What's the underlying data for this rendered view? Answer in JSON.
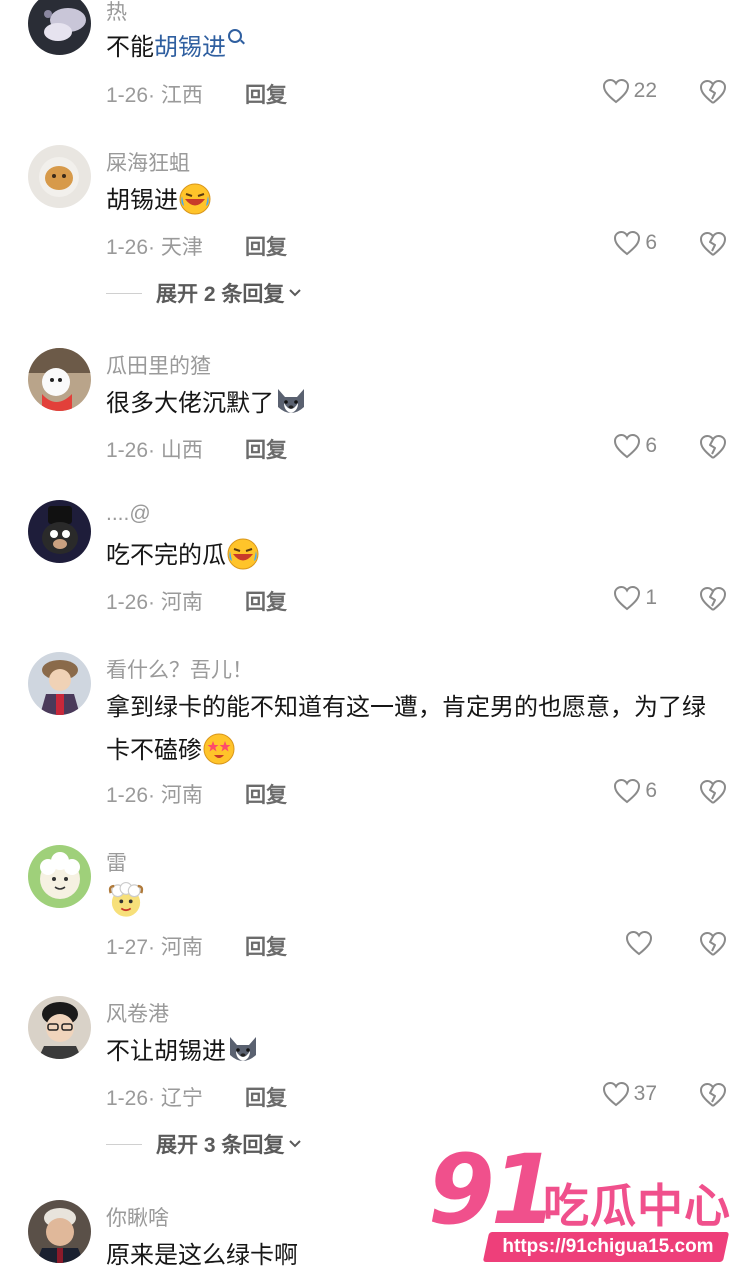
{
  "comments": [
    {
      "username": "热",
      "text_before": "不能",
      "keyword": "胡锡进",
      "text_after": "",
      "meta": "1-26· 江西",
      "reply": "回复",
      "likes": "22",
      "emoji": ""
    },
    {
      "username": "屎海狂蛆",
      "text_before": "胡锡进",
      "meta": "1-26· 天津",
      "reply": "回复",
      "likes": "6",
      "emoji": "laughing-crying-emoji",
      "expand": "展开 2 条回复"
    },
    {
      "username": "瓜田里的猹",
      "text_before": "很多大佬沉默了",
      "meta": "1-26· 山西",
      "reply": "回复",
      "likes": "6",
      "emoji": "husky-emoji"
    },
    {
      "username": "....@",
      "text_before": "吃不完的瓜",
      "meta": "1-26· 河南",
      "reply": "回复",
      "likes": "1",
      "emoji": "laughing-crying-emoji"
    },
    {
      "username": "看什么？吾儿！",
      "text_before": "拿到绿卡的能不知道有这一遭，肯定男的也愿意，为了绿卡不磕碜",
      "meta": "1-26· 河南",
      "reply": "回复",
      "likes": "6",
      "emoji": "starry-eyes-emoji"
    },
    {
      "username": "雷",
      "text_before": "",
      "meta": "1-27· 河南",
      "reply": "回复",
      "likes": "",
      "emoji": "sheep-sticker"
    },
    {
      "username": "风卷港",
      "text_before": "不让胡锡进",
      "meta": "1-26· 辽宁",
      "reply": "回复",
      "likes": "37",
      "emoji": "husky-emoji",
      "expand": "展开 3 条回复"
    },
    {
      "username": "你瞅啥",
      "text_before": "原来是这么绿卡啊"
    }
  ],
  "watermark": {
    "number": "91",
    "title": "吃瓜中心",
    "url": "https://91chigua15.com"
  },
  "colors": {
    "background": "#ffffff",
    "username": "#9a9a9a",
    "keyword_link": "#2f5fa0",
    "watermark_pink": "#f0508c"
  }
}
